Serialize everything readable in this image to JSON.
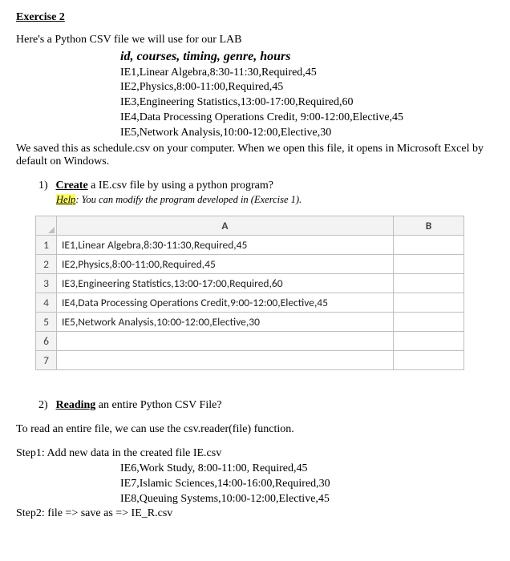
{
  "title": "Exercise 2",
  "intro": "Here's a Python CSV file we will use for our LAB",
  "csv_header": "id, courses, timing, genre, hours",
  "csv_lines": [
    "IE1,Linear Algebra,8:30-11:30,Required,45",
    "IE2,Physics,8:00-11:00,Required,45",
    "IE3,Engineering Statistics,13:00-17:00,Required,60",
    "IE4,Data Processing Operations Credit, 9:00-12:00,Elective,45",
    "IE5,Network Analysis,10:00-12:00,Elective,30"
  ],
  "after_csv": "We saved this as schedule.csv on your computer. When we open this file, it opens in Microsoft Excel by default on Windows.",
  "q1": {
    "num": "1)",
    "label": "Create",
    "rest": " a IE.csv file by using a python program?",
    "help_label": "Help",
    "help_text": ": You can modify the program developed in (Exercise 1)."
  },
  "excel": {
    "colA": "A",
    "colB": "B",
    "rows": [
      "IE1,Linear Algebra,8:30-11:30,Required,45",
      "IE2,Physics,8:00-11:00,Required,45",
      "IE3,Engineering Statistics,13:00-17:00,Required,60",
      "IE4,Data Processing Operations Credit,9:00-12:00,Elective,45",
      "IE5,Network Analysis,10:00-12:00,Elective,30"
    ],
    "rownums": [
      "1",
      "2",
      "3",
      "4",
      "5",
      "6",
      "7"
    ]
  },
  "q2": {
    "num": "2)",
    "label": "Reading",
    "rest": " an entire Python CSV File?"
  },
  "read_sentence": "To read an entire file, we can use the csv.reader(file) function.",
  "step1_label": "Step1: Add new data in the created file IE.csv",
  "step1_lines": [
    "IE6,Work Study, 8:00-11:00, Required,45",
    "IE7,Islamic Sciences,14:00-16:00,Required,30",
    "IE8,Queuing Systems,10:00-12:00,Elective,45"
  ],
  "step2_label": "Step2: file => save as => IE_R.csv"
}
